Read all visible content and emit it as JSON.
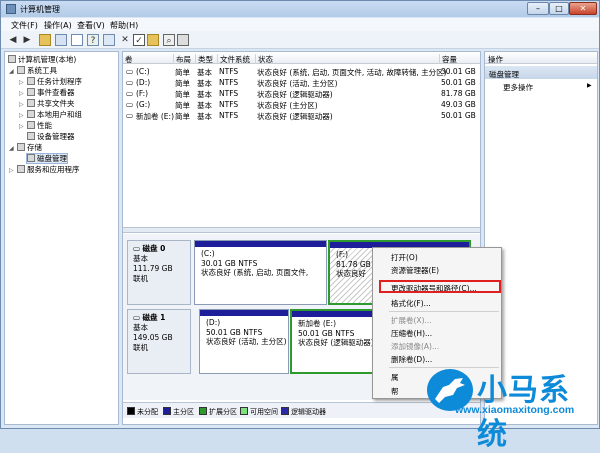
{
  "window": {
    "title": "计算机管理"
  },
  "menu": [
    "文件(F)",
    "操作(A)",
    "查看(V)",
    "帮助(H)"
  ],
  "tree": {
    "root": "计算机管理(本地)",
    "system_tools": "系统工具",
    "task_scheduler": "任务计划程序",
    "event_viewer": "事件查看器",
    "shared_folders": "共享文件夹",
    "local_users": "本地用户和组",
    "performance": "性能",
    "device_manager": "设备管理器",
    "storage": "存储",
    "disk_management": "磁盘管理",
    "services": "服务和应用程序"
  },
  "volumes": {
    "columns": [
      "卷",
      "布局",
      "类型",
      "文件系统",
      "状态",
      "容量"
    ],
    "rows": [
      [
        "(C:)",
        "简单",
        "基本",
        "NTFS",
        "状态良好 (系统, 启动, 页面文件, 活动, 故障转储, 主分区)",
        "30.01 GB"
      ],
      [
        "(D:)",
        "简单",
        "基本",
        "NTFS",
        "状态良好 (活动, 主分区)",
        "50.01 GB"
      ],
      [
        "(F:)",
        "简单",
        "基本",
        "NTFS",
        "状态良好 (逻辑驱动器)",
        "81.78 GB"
      ],
      [
        "(G:)",
        "简单",
        "基本",
        "NTFS",
        "状态良好 (主分区)",
        "49.03 GB"
      ],
      [
        "新加卷 (E:)",
        "简单",
        "基本",
        "NTFS",
        "状态良好 (逻辑驱动器)",
        "50.01 GB"
      ]
    ]
  },
  "disks": [
    {
      "name": "磁盘 0",
      "type": "基本",
      "size": "111.79 GB",
      "status": "联机",
      "parts": [
        {
          "label": "(C:)",
          "size": "30.01 GB NTFS",
          "status": "状态良好 (系统, 启动, 页面文件,"
        },
        {
          "label": "(F:)",
          "size": "81.78 GB N",
          "status": "状态良好"
        }
      ]
    },
    {
      "name": "磁盘 1",
      "type": "基本",
      "size": "149.05 GB",
      "status": "联机",
      "parts": [
        {
          "label": "(D:)",
          "size": "50.01 GB NTFS",
          "status": "状态良好 (活动, 主分区)"
        },
        {
          "label": "新加卷 (E:)",
          "size": "50.01 GB NTFS",
          "status": "状态良好 (逻辑驱动器)"
        },
        {
          "label": "",
          "size": "",
          "status": ""
        }
      ]
    }
  ],
  "legend": [
    "未分配",
    "主分区",
    "扩展分区",
    "可用空间",
    "逻辑驱动器"
  ],
  "legend_colors": [
    "#000000",
    "#1e1e9a",
    "#2e9a2e",
    "#7ee07e",
    "#2a2aa8"
  ],
  "actions": {
    "header": "操作",
    "section": "磁盘管理",
    "more": "更多操作"
  },
  "context_menu": {
    "open": "打开(O)",
    "explorer": "资源管理器(E)",
    "change_letter": "更改驱动器号和路径(C)...",
    "format": "格式化(F)...",
    "extend": "扩展卷(X)...",
    "shrink": "压缩卷(H)...",
    "mirror": "添加镜像(A)...",
    "delete": "删除卷(D)...",
    "properties": "属",
    "help": "帮"
  },
  "watermark": {
    "brand": "小马系统",
    "url": "www.xiaomaxitong.com"
  }
}
